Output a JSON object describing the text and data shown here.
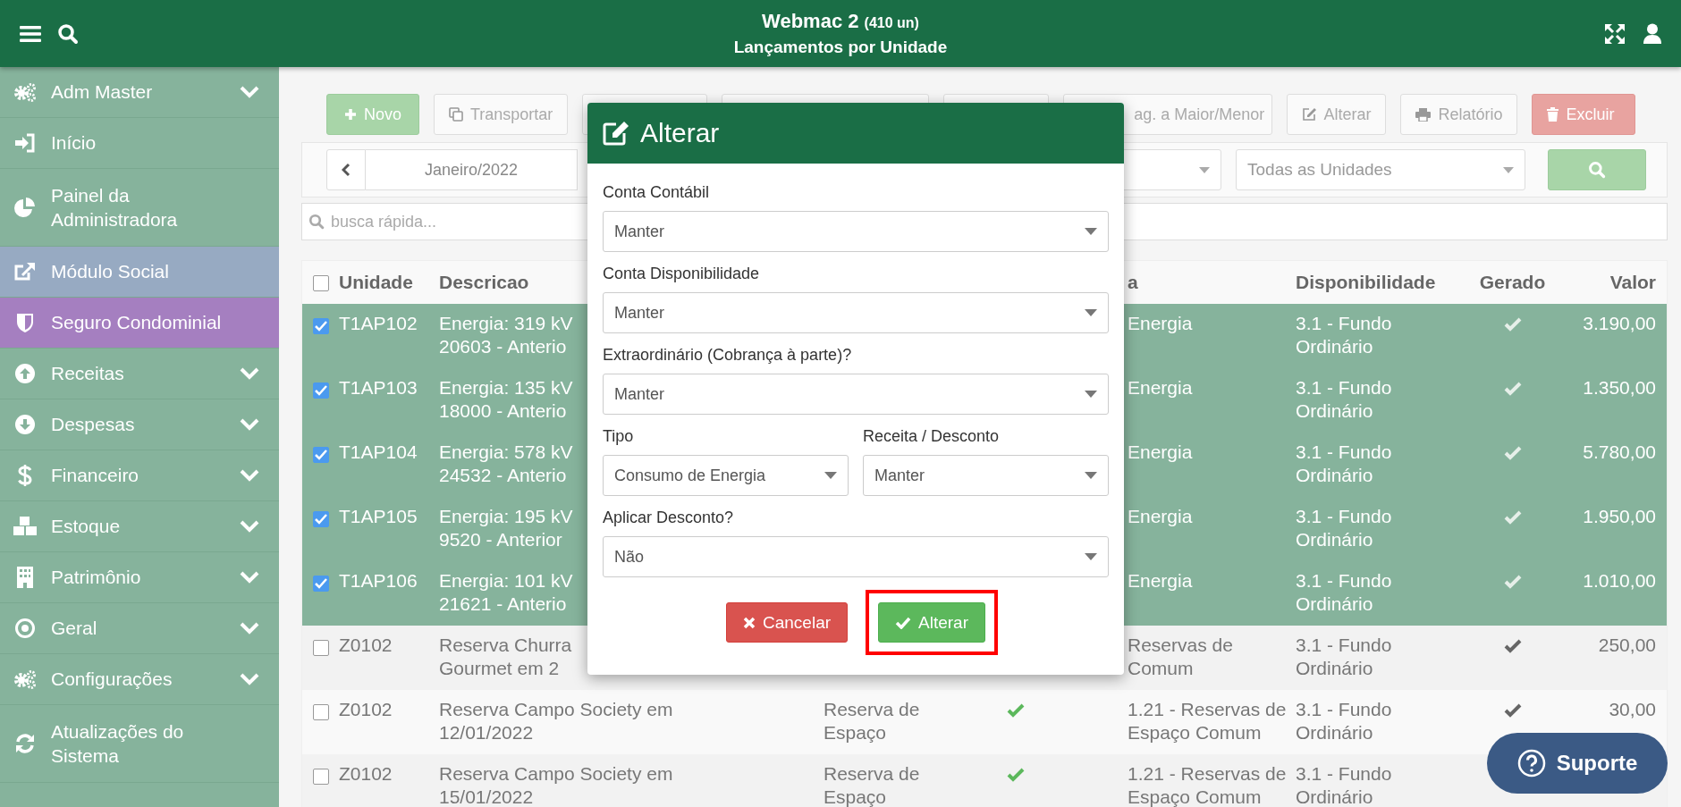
{
  "header": {
    "title": "Webmac 2",
    "count": "(410 un)",
    "subtitle": "Lançamentos por Unidade"
  },
  "sidebar": {
    "items": [
      {
        "label": "Adm Master",
        "has_submenu": true
      },
      {
        "label": "Início",
        "has_submenu": false
      },
      {
        "label": "Painel da Administradora",
        "has_submenu": false
      },
      {
        "label": "Módulo Social",
        "has_submenu": false,
        "color": "#97aac2"
      },
      {
        "label": "Seguro Condominial",
        "has_submenu": false,
        "color": "#a57fc0"
      },
      {
        "label": "Receitas",
        "has_submenu": true
      },
      {
        "label": "Despesas",
        "has_submenu": true
      },
      {
        "label": "Financeiro",
        "has_submenu": true
      },
      {
        "label": "Estoque",
        "has_submenu": true
      },
      {
        "label": "Patrimônio",
        "has_submenu": true
      },
      {
        "label": "Geral",
        "has_submenu": true
      },
      {
        "label": "Configurações",
        "has_submenu": true
      },
      {
        "label": "Atualizações do Sistema",
        "has_submenu": false
      }
    ]
  },
  "toolbar": [
    {
      "kind": "new",
      "label": "Novo"
    },
    {
      "kind": "copy",
      "label": "Transportar"
    },
    {
      "kind": "hidden"
    },
    {
      "kind": "hidden"
    },
    {
      "kind": "hidden"
    },
    {
      "kind": "partial",
      "label": "ag. a Maior/Menor"
    },
    {
      "kind": "edit",
      "label": "Alterar"
    },
    {
      "kind": "print",
      "label": "Relatório"
    },
    {
      "kind": "delete",
      "label": "Excluir"
    }
  ],
  "filters": {
    "month": "Janeiro/2022",
    "units": "Todas as Unidades"
  },
  "quick_search": {
    "placeholder": "busca rápida..."
  },
  "table": {
    "all_selected": false,
    "columns": [
      "Unidade",
      "Descricao",
      "a",
      "Disponibilidade",
      "Gerado",
      "Valor"
    ],
    "rows": [
      {
        "selected": true,
        "unit": "T1AP102",
        "description": [
          "Energia: 319 kV",
          "20603 - Anterio"
        ],
        "account": [
          "Energia"
        ],
        "availability": [
          "3.1 - Fundo",
          "Ordinário"
        ],
        "generated": true,
        "value": "3.190,00"
      },
      {
        "selected": true,
        "unit": "T1AP103",
        "description": [
          "Energia: 135 kV",
          "18000 - Anterio"
        ],
        "account": [
          "Energia"
        ],
        "availability": [
          "3.1 - Fundo",
          "Ordinário"
        ],
        "generated": true,
        "value": "1.350,00"
      },
      {
        "selected": true,
        "unit": "T1AP104",
        "description": [
          "Energia: 578 kV",
          "24532 - Anterio"
        ],
        "account": [
          "Energia"
        ],
        "availability": [
          "3.1 - Fundo",
          "Ordinário"
        ],
        "generated": true,
        "value": "5.780,00"
      },
      {
        "selected": true,
        "unit": "T1AP105",
        "description": [
          "Energia: 195 kV",
          "9520 - Anterior"
        ],
        "account": [
          "Energia"
        ],
        "availability": [
          "3.1 - Fundo",
          "Ordinário"
        ],
        "generated": true,
        "value": "1.950,00"
      },
      {
        "selected": true,
        "unit": "T1AP106",
        "description": [
          "Energia: 101 kV",
          "21621 - Anterio"
        ],
        "account": [
          "Energia"
        ],
        "availability": [
          "3.1 - Fundo",
          "Ordinário"
        ],
        "generated": true,
        "value": "1.010,00"
      },
      {
        "selected": false,
        "unit": "Z0102",
        "description": [
          "Reserva Churra",
          "Gourmet em 2"
        ],
        "account": [
          "Reservas de",
          "Comum"
        ],
        "availability": [
          "3.1 - Fundo",
          "Ordinário"
        ],
        "generated": true,
        "value": "250,00"
      },
      {
        "selected": false,
        "unit": "Z0102",
        "description": [
          "Reserva Campo Society em",
          "12/01/2022"
        ],
        "type": [
          "Reserva de",
          "Espaço"
        ],
        "type_ok": true,
        "account": [
          "1.21 - Reservas de",
          "Espaço Comum"
        ],
        "availability": [
          "3.1 - Fundo",
          "Ordinário"
        ],
        "generated": true,
        "value": "30,00"
      },
      {
        "selected": false,
        "unit": "Z0102",
        "description": [
          "Reserva Campo Society em",
          "15/01/2022"
        ],
        "type": [
          "Reserva de",
          "Espaço"
        ],
        "type_ok": true,
        "account": [
          "1.21 - Reservas de",
          "Espaço Comum"
        ],
        "availability": [
          "3.1 - Fundo",
          "Ordinário"
        ]
      }
    ]
  },
  "dialog": {
    "title": "Alterar",
    "field_rows": [
      [
        {
          "label": "Conta Contábil",
          "value": "Manter"
        }
      ],
      [
        {
          "label": "Conta Disponibilidade",
          "value": "Manter"
        }
      ],
      [
        {
          "label": "Extraordinário (Cobrança à parte)?",
          "value": "Manter"
        }
      ],
      [
        {
          "label": "Tipo",
          "value": "Consumo de Energia"
        },
        {
          "label": "Receita / Desconto",
          "value": "Manter"
        }
      ],
      [
        {
          "label": "Aplicar Desconto?",
          "value": "Não"
        }
      ]
    ],
    "buttons": [
      {
        "kind": "cancel",
        "label": "Cancelar",
        "highlighted": false
      },
      {
        "kind": "confirm",
        "label": "Alterar",
        "highlighted": true
      }
    ]
  },
  "support_button": {
    "label": "Suporte"
  }
}
